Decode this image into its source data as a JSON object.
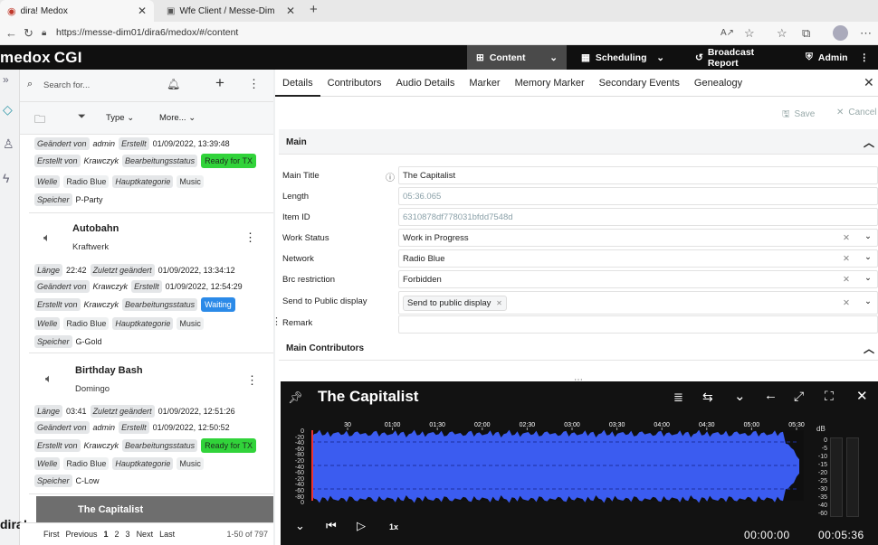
{
  "browser": {
    "tabs": [
      {
        "label": "dira! Medox",
        "active": true
      },
      {
        "label": "Wfe Client / Messe-Dim",
        "active": false
      }
    ],
    "url": "https://messe-dim01/dira6/medox/#/content"
  },
  "app": {
    "logo": "medox",
    "logo_suffix": "CGI",
    "nav": {
      "content": "Content",
      "scheduling": "Scheduling",
      "broadcast_report": "Broadcast Report",
      "admin": "Admin"
    }
  },
  "list": {
    "search_placeholder": "Search for...",
    "filter_type": "Type",
    "filter_more": "More...",
    "first_card": {
      "changed_by_label": "Geändert von",
      "changed_by": "admin",
      "created_label": "Erstellt",
      "created": "01/09/2022, 13:39:48",
      "created_by_label": "Erstellt von",
      "created_by": "Krawczyk",
      "edit_status_label": "Bearbeitungsstatus",
      "edit_status": "Ready for TX",
      "wave_label": "Welle",
      "wave": "Radio Blue",
      "category_label": "Hauptkategorie",
      "category": "Music",
      "storage_label": "Speicher",
      "storage": "P-Party"
    },
    "cards": [
      {
        "title": "Autobahn",
        "artist": "Kraftwerk",
        "length_label": "Länge",
        "length": "22:42",
        "last_changed_label": "Zuletzt geändert",
        "last_changed": "01/09/2022, 13:34:12",
        "changed_by_label": "Geändert von",
        "changed_by": "Krawczyk",
        "created_label": "Erstellt",
        "created": "01/09/2022, 12:54:29",
        "created_by_label": "Erstellt von",
        "created_by": "Krawczyk",
        "edit_status_label": "Bearbeitungsstatus",
        "edit_status": "Waiting",
        "wave_label": "Welle",
        "wave": "Radio Blue",
        "category_label": "Hauptkategorie",
        "category": "Music",
        "storage_label": "Speicher",
        "storage": "G-Gold"
      },
      {
        "title": "Birthday Bash",
        "artist": "Domingo",
        "length_label": "Länge",
        "length": "03:41",
        "last_changed_label": "Zuletzt geändert",
        "last_changed": "01/09/2022, 12:51:26",
        "changed_by_label": "Geändert von",
        "changed_by": "admin",
        "created_label": "Erstellt",
        "created": "01/09/2022, 12:50:52",
        "created_by_label": "Erstellt von",
        "created_by": "Krawczyk",
        "edit_status_label": "Bearbeitungsstatus",
        "edit_status": "Ready for TX",
        "wave_label": "Welle",
        "wave": "Radio Blue",
        "category_label": "Hauptkategorie",
        "category": "Music",
        "storage_label": "Speicher",
        "storage": "C-Low"
      }
    ],
    "selected_title": "The Capitalist",
    "pager": {
      "first": "First",
      "previous": "Previous",
      "pages": [
        "1",
        "2",
        "3"
      ],
      "next": "Next",
      "last": "Last",
      "range": "1-50 of 797"
    },
    "brand": "dira!"
  },
  "details": {
    "tabs": [
      "Details",
      "Contributors",
      "Audio Details",
      "Marker",
      "Memory Marker",
      "Secondary Events",
      "Genealogy"
    ],
    "save": "Save",
    "cancel": "Cancel",
    "section_main": "Main",
    "section_contributors": "Main Contributors",
    "fields": {
      "main_title_label": "Main Title",
      "main_title": "The Capitalist",
      "length_label": "Length",
      "length": "05:36.065",
      "item_id_label": "Item ID",
      "item_id": "6310878df778031bfdd7548d",
      "work_status_label": "Work Status",
      "work_status": "Work in Progress",
      "network_label": "Network",
      "network": "Radio Blue",
      "brc_label": "Brc restriction",
      "brc": "Forbidden",
      "public_display_label": "Send to Public display",
      "public_display_chip": "Send to public display",
      "remark_label": "Remark"
    }
  },
  "player": {
    "title": "The Capitalist",
    "time_ticks": [
      "30",
      "01:00",
      "01:30",
      "02:00",
      "02:30",
      "03:00",
      "03:30",
      "04:00",
      "04:30",
      "05:00",
      "05:30"
    ],
    "db_ticks": [
      "0",
      "-20",
      "-40",
      "-60",
      "-80",
      "-20",
      "-40",
      "-60",
      "-20",
      "-40",
      "-60",
      "-80",
      "0"
    ],
    "meter_unit": "dB",
    "meter_ticks": [
      "0",
      "-5",
      "-10",
      "-15",
      "-20",
      "-25",
      "-30",
      "-35",
      "-40",
      "-60"
    ],
    "speed": "1x",
    "current_time": "00:00:00",
    "total_time": "00:05:36",
    "waveform_color": "#3b5cf0"
  }
}
